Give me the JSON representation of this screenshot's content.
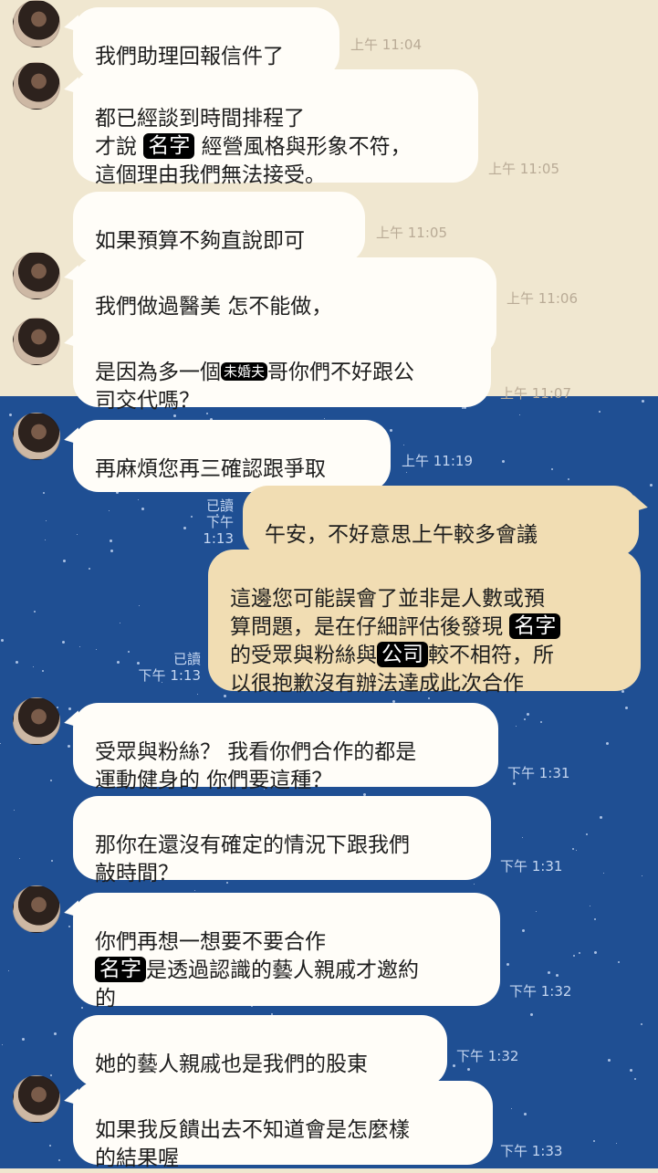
{
  "colors": {
    "top_bg": "#f0e7d0",
    "bottom_bg": "#1f4f93",
    "incoming_bubble": "#fffdf8",
    "outgoing_bubble": "#f1ddb3"
  },
  "messages": [
    {
      "text": "我們助理回報信件了",
      "time": "上午 11:04"
    },
    {
      "line1": "都已經談到時間排程了",
      "line2_pre": "才說 ",
      "line2_tag": "名字",
      "line2_post": " 經營風格與形象不符，",
      "line3": "這個理由我們無法接受。",
      "time": "上午 11:05"
    },
    {
      "text": "如果預算不夠直說即可",
      "time": "上午 11:05"
    },
    {
      "text": "我們做過醫美 怎不能做，",
      "mark": "？",
      "time": "上午 11:06"
    },
    {
      "line1_pre": "是因為多一個",
      "line1_tag": "未婚夫",
      "line1_post": "哥你們不好跟公",
      "line2": "司交代嗎？",
      "time": "上午 11:07"
    },
    {
      "text": "再麻煩您再三確認跟爭取",
      "time": "上午 11:19"
    },
    {
      "text": "午安，不好意思上午較多會議",
      "read": "已讀",
      "time": "下午 1:13"
    },
    {
      "line1": "這邊您可能誤會了並非是人數或預",
      "line2_pre": "算問題，是在仔細評估後發現 ",
      "line2_tag": "名字",
      "line3_pre": "的受眾與粉絲與",
      "line3_tag": "公司",
      "line3_post": "較不相符，所",
      "line4": "以很抱歉沒有辦法達成此次合作",
      "read": "已讀",
      "time": "下午 1:13"
    },
    {
      "line1": "受眾與粉絲？ 我看你們合作的都是",
      "line2": "運動健身的 你們要這種？",
      "time": "下午 1:31"
    },
    {
      "line1": "那你在還沒有確定的情況下跟我們",
      "line2": "敲時間？",
      "time": "下午 1:31"
    },
    {
      "line1": "你們再想一想要不要合作",
      "line2_tag": "名字",
      "line2_post": "是透過認識的藝人親戚才邀約",
      "line3": "的",
      "time": "下午 1:32"
    },
    {
      "text": "她的藝人親戚也是我們的股東",
      "time": "下午 1:32"
    },
    {
      "line1": "如果我反饋出去不知道會是怎麼樣",
      "line2": "的結果喔",
      "time": "下午 1:33"
    }
  ]
}
